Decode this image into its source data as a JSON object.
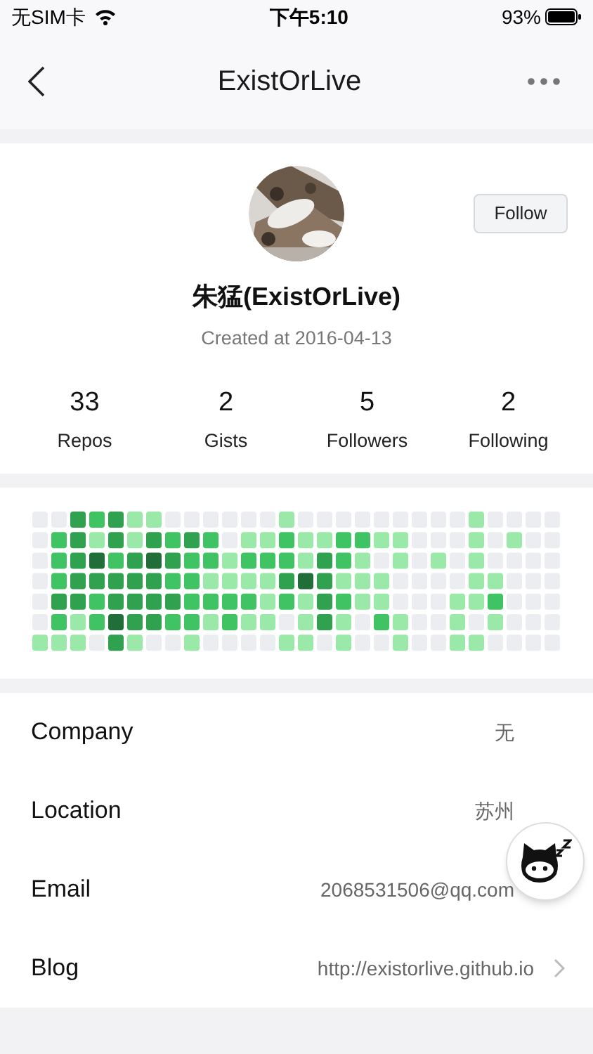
{
  "status_bar": {
    "carrier": "无SIM卡",
    "time": "下午5:10",
    "battery": "93%"
  },
  "nav": {
    "title": "ExistOrLive"
  },
  "profile": {
    "follow_button": "Follow",
    "name": "朱猛(ExistOrLive)",
    "created": "Created at 2016-04-13",
    "stats": [
      {
        "value": "33",
        "label": "Repos"
      },
      {
        "value": "2",
        "label": "Gists"
      },
      {
        "value": "5",
        "label": "Followers"
      },
      {
        "value": "2",
        "label": "Following"
      }
    ]
  },
  "info_rows": [
    {
      "label": "Company",
      "value": "无",
      "chevron": false
    },
    {
      "label": "Location",
      "value": "苏州",
      "chevron": false
    },
    {
      "label": "Email",
      "value": "2068531506@qq.com",
      "chevron": false
    },
    {
      "label": "Blog",
      "value": "http://existorlive.github.io",
      "chevron": true
    }
  ]
}
